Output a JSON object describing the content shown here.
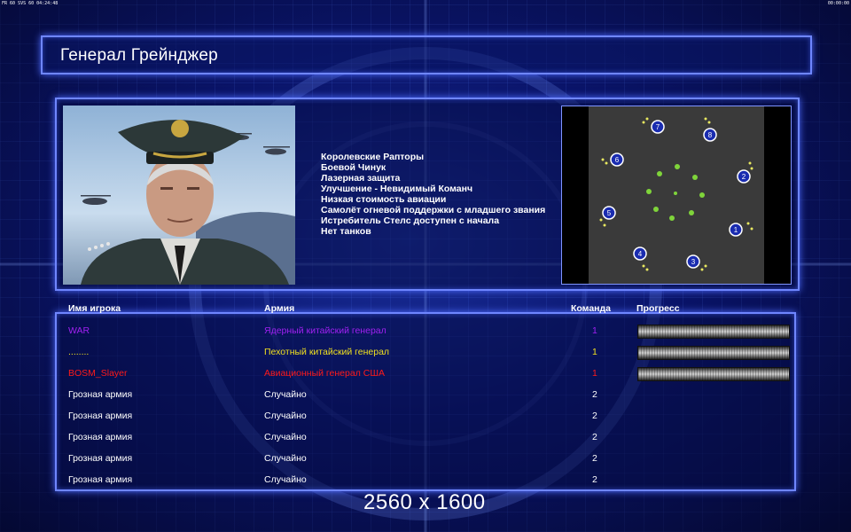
{
  "topbar": {
    "left": "FR 60 SVS 60 04:24:48",
    "right": "00:00:00"
  },
  "title": "Генерал Грейнджер",
  "features": [
    "Королевские Рапторы",
    "Боевой Чинук",
    "Лазерная защита",
    "Улучшение - Невидимый Команч",
    "Низкая стоимость авиации",
    "Самолёт огневой поддержки с младшего звания",
    "Истребитель Стелс доступен с начала",
    "Нет танков"
  ],
  "map": {
    "starts": [
      "1",
      "2",
      "3",
      "4",
      "5",
      "6",
      "7",
      "8"
    ]
  },
  "table": {
    "headers": {
      "player": "Имя игрока",
      "army": "Армия",
      "team": "Команда",
      "progress": "Прогресс"
    },
    "rows": [
      {
        "player": "WAR",
        "army": "Ядерный китайский генерал",
        "team": "1",
        "color": "#a020f0",
        "has_progress": true
      },
      {
        "player": "........",
        "army": "Пехотный китайский генерал",
        "team": "1",
        "color": "#f0e020",
        "has_progress": true
      },
      {
        "player": "BOSM_Slayer",
        "army": "Авиационный генерал США",
        "team": "1",
        "color": "#ff1a1a",
        "has_progress": true
      },
      {
        "player": "Грозная армия",
        "army": "Случайно",
        "team": "2",
        "color": "#ffffff",
        "has_progress": false
      },
      {
        "player": "Грозная армия",
        "army": "Случайно",
        "team": "2",
        "color": "#ffffff",
        "has_progress": false
      },
      {
        "player": "Грозная армия",
        "army": "Случайно",
        "team": "2",
        "color": "#ffffff",
        "has_progress": false
      },
      {
        "player": "Грозная армия",
        "army": "Случайно",
        "team": "2",
        "color": "#ffffff",
        "has_progress": false
      },
      {
        "player": "Грозная армия",
        "army": "Случайно",
        "team": "2",
        "color": "#ffffff",
        "has_progress": false
      }
    ]
  },
  "watermark": "2560 x 1600"
}
